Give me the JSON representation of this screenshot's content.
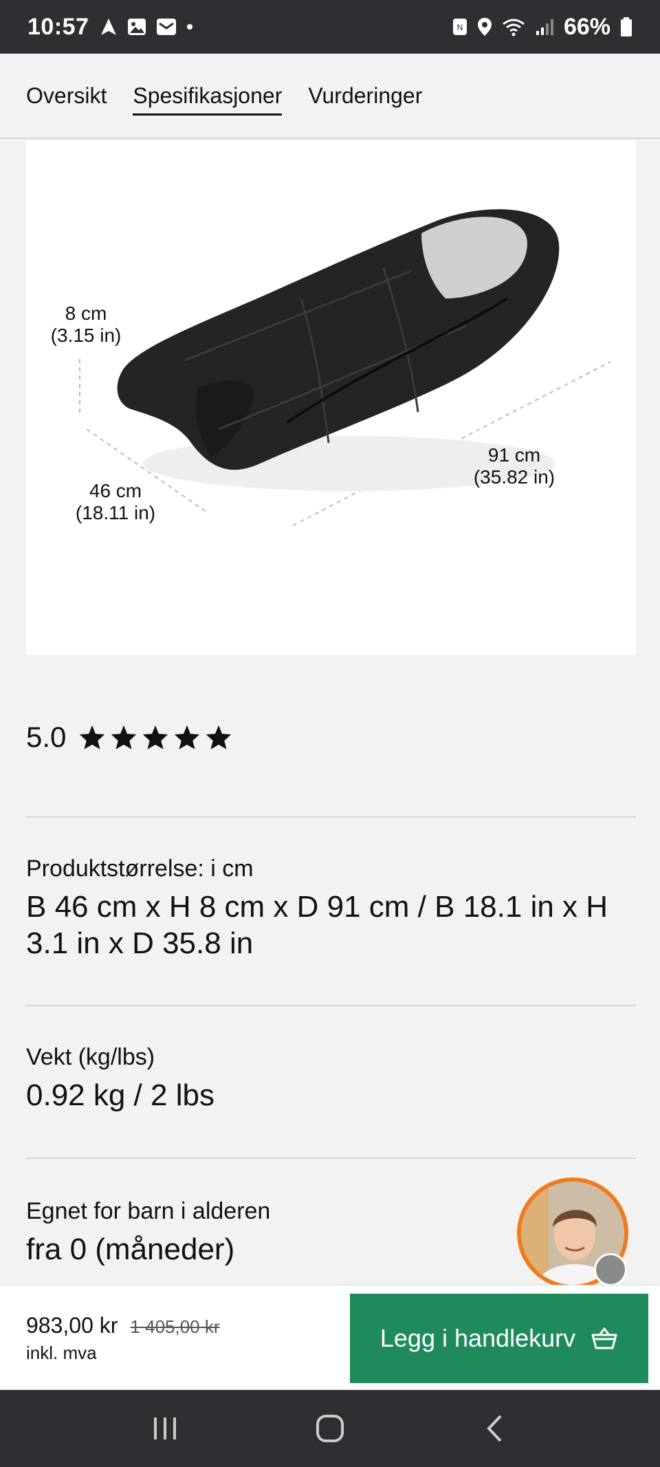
{
  "status_bar": {
    "time": "10:57",
    "battery": "66%"
  },
  "tabs": [
    {
      "label": "Oversikt",
      "active": false
    },
    {
      "label": "Spesifikasjoner",
      "active": true
    },
    {
      "label": "Vurderinger",
      "active": false
    }
  ],
  "product_image": {
    "height_cm": "8 cm",
    "height_in": "(3.15 in)",
    "width_cm": "46 cm",
    "width_in": "(18.11 in)",
    "length_cm": "91 cm",
    "length_in": "(35.82 in)"
  },
  "rating": {
    "value": "5.0",
    "stars": 5
  },
  "specs": [
    {
      "label": "Produktstørrelse: i cm",
      "value": "B 46 cm x H 8 cm x D 91 cm / B 18.1 in x H 3.1 in x D 35.8 in"
    },
    {
      "label": "Vekt (kg/lbs)",
      "value": "0.92 kg / 2 lbs"
    },
    {
      "label": "Egnet for barn i alderen",
      "value": "fra 0 (måneder)"
    }
  ],
  "cart": {
    "price": "983,00 kr",
    "old_price": "1 405,00 kr",
    "vat_note": "inkl. mva",
    "button_label": "Legg i handlekurv"
  },
  "colors": {
    "accent_green": "#1f8a5b",
    "chat_ring": "#f07b1e",
    "system_bar": "#2e2f33"
  }
}
